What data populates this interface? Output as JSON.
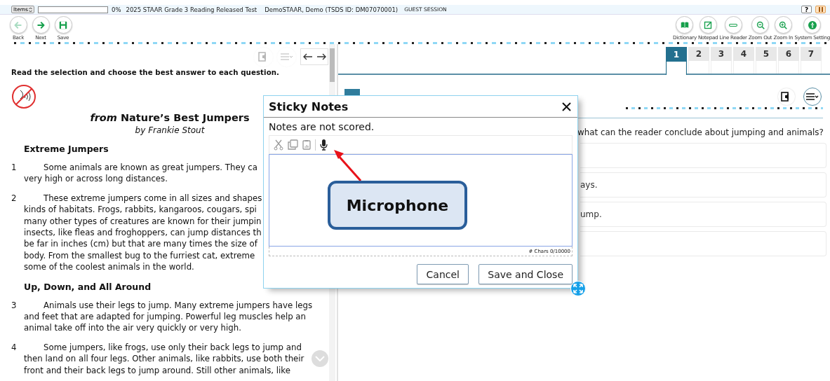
{
  "top_bar": {
    "items_menu": "Items",
    "progress": {
      "level": 0
    },
    "progress_text": "0%",
    "test_title": "2025 STAAR Grade 3 Reading Released Test",
    "student": "DemoSTAAR, Demo (TSDS ID: DM07070001)",
    "session": "GUEST SESSION",
    "help_button": "?"
  },
  "toolbar": {
    "left": [
      {
        "kind": "back",
        "label": "Back",
        "disabled": true
      },
      {
        "kind": "next",
        "label": "Next",
        "disabled": false
      },
      {
        "kind": "save",
        "label": "Save",
        "disabled": false
      }
    ],
    "right": [
      {
        "kind": "dictionary",
        "label": "Dictionary",
        "disabled": false
      },
      {
        "kind": "notepad",
        "label": "Notepad",
        "disabled": false
      },
      {
        "kind": "line-reader",
        "label": "Line Reader",
        "disabled": false
      },
      {
        "kind": "zoom-out",
        "label": "Zoom Out",
        "disabled": false
      },
      {
        "kind": "zoom-in",
        "label": "Zoom In",
        "disabled": false
      },
      {
        "kind": "settings",
        "label": "System Setting",
        "disabled": false
      }
    ]
  },
  "question_tabs": [
    {
      "label": "1",
      "selected": true
    },
    {
      "label": "2",
      "selected": false
    },
    {
      "label": "3",
      "selected": false
    },
    {
      "label": "4",
      "selected": false
    },
    {
      "label": "5",
      "selected": false
    },
    {
      "label": "6",
      "selected": false
    },
    {
      "label": "7",
      "selected": false
    }
  ],
  "passage": {
    "instruction": "Read the selection and choose the best answer to each question.",
    "title": "*from* Nature’s Best Jumpers",
    "byline": "by Frankie Stout",
    "blocks": [
      {
        "kind": "heading",
        "text": "Extreme Jumpers"
      },
      {
        "kind": "paragraph",
        "number": "1",
        "lines": [
          "Some animals are known as great jumpers. They ca",
          "very high or across long distances."
        ]
      },
      {
        "kind": "paragraph",
        "number": "2",
        "lines": [
          "These extreme jumpers come in all sizes and shapes",
          "kinds of habitats. Frogs, rabbits, kangaroos, cougars, spi",
          "many other types of creatures are known for their jumpin",
          "insects, like fleas and froghoppers, can jump distances th",
          "be far in inches (cm) but that are many times the size of",
          "body. From the smallest bug to the furriest cat, extreme",
          "some of the coolest animals in the world."
        ]
      },
      {
        "kind": "heading",
        "text": "Up, Down, and All Around"
      },
      {
        "kind": "paragraph",
        "number": "3",
        "lines": [
          "Animals use their legs to jump. Many extreme jumpers have legs",
          "and feet that are adapted for jumping. Powerful leg muscles help an",
          "animal take off into the air very quickly or very high."
        ]
      },
      {
        "kind": "paragraph",
        "number": "4",
        "lines": [
          "Some jumpers, like frogs, use only their back legs to jump and",
          "then land on all four legs. Other animals, like rabbits, use both their",
          "front and their back legs to jump around. Still other animals, like"
        ]
      }
    ]
  },
  "item": {
    "question": "what can the reader conclude about jumping and animals?",
    "options": [
      {
        "kind": "covered"
      },
      {
        "kind": "text",
        "text": "ays."
      },
      {
        "kind": "text",
        "text": "ump."
      },
      {
        "kind": "covered"
      }
    ]
  },
  "sticky_notes": {
    "title": "Sticky Notes",
    "notice": "Notes are not scored.",
    "char_count": "# Chars 0/10000",
    "buttons": [
      {
        "kind": "cancel",
        "label": "Cancel"
      },
      {
        "kind": "save",
        "label": "Save and Close"
      }
    ]
  },
  "callout": {
    "text": "Microphone"
  }
}
